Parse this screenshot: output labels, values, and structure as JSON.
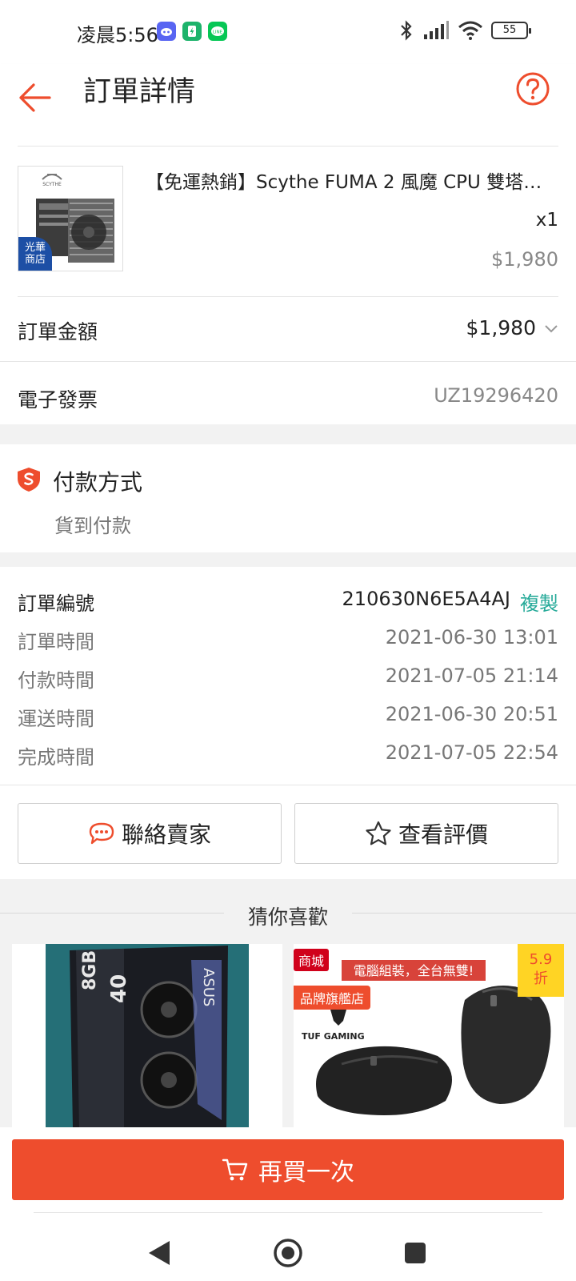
{
  "status_bar": {
    "time": "凌晨5:56",
    "battery": "55"
  },
  "header": {
    "title": "訂單詳情"
  },
  "product": {
    "title": "【免運熱銷】Scythe FUMA 2 風魔 CPU 雙塔…",
    "quantity": "x1",
    "price": "$1,980",
    "badge": "光華\n商店"
  },
  "order_amount": {
    "label": "訂單金額",
    "value": "$1,980"
  },
  "invoice": {
    "label": "電子發票",
    "value": "UZ19296420"
  },
  "payment": {
    "title": "付款方式",
    "method": "貨到付款"
  },
  "order_info": {
    "number_label": "訂單編號",
    "number_value": "210630N6E5A4AJ",
    "copy_label": "複製",
    "rows": [
      {
        "label": "訂單時間",
        "value": "2021-06-30 13:01"
      },
      {
        "label": "付款時間",
        "value": "2021-07-05 21:14"
      },
      {
        "label": "運送時間",
        "value": "2021-06-30 20:51"
      },
      {
        "label": "完成時間",
        "value": "2021-07-05 22:54"
      }
    ]
  },
  "actions": {
    "contact_seller": "聯絡賣家",
    "view_review": "查看評價"
  },
  "recommendations": {
    "title": "猜你喜歡",
    "items": [
      {
        "box_text": "8GB",
        "model": "40",
        "brand": "ASUS"
      },
      {
        "mall_badge": "商城",
        "flagship_badge": "品牌旗艦店",
        "discount": "5.9\n折",
        "banner": "電腦組裝，全台無雙!",
        "brand": "TUF GAMING"
      }
    ]
  },
  "buy_again": {
    "label": "再買一次"
  },
  "colors": {
    "accent": "#ee4d2d",
    "teal": "#26aa99",
    "yellow_badge": "#ffd424"
  }
}
